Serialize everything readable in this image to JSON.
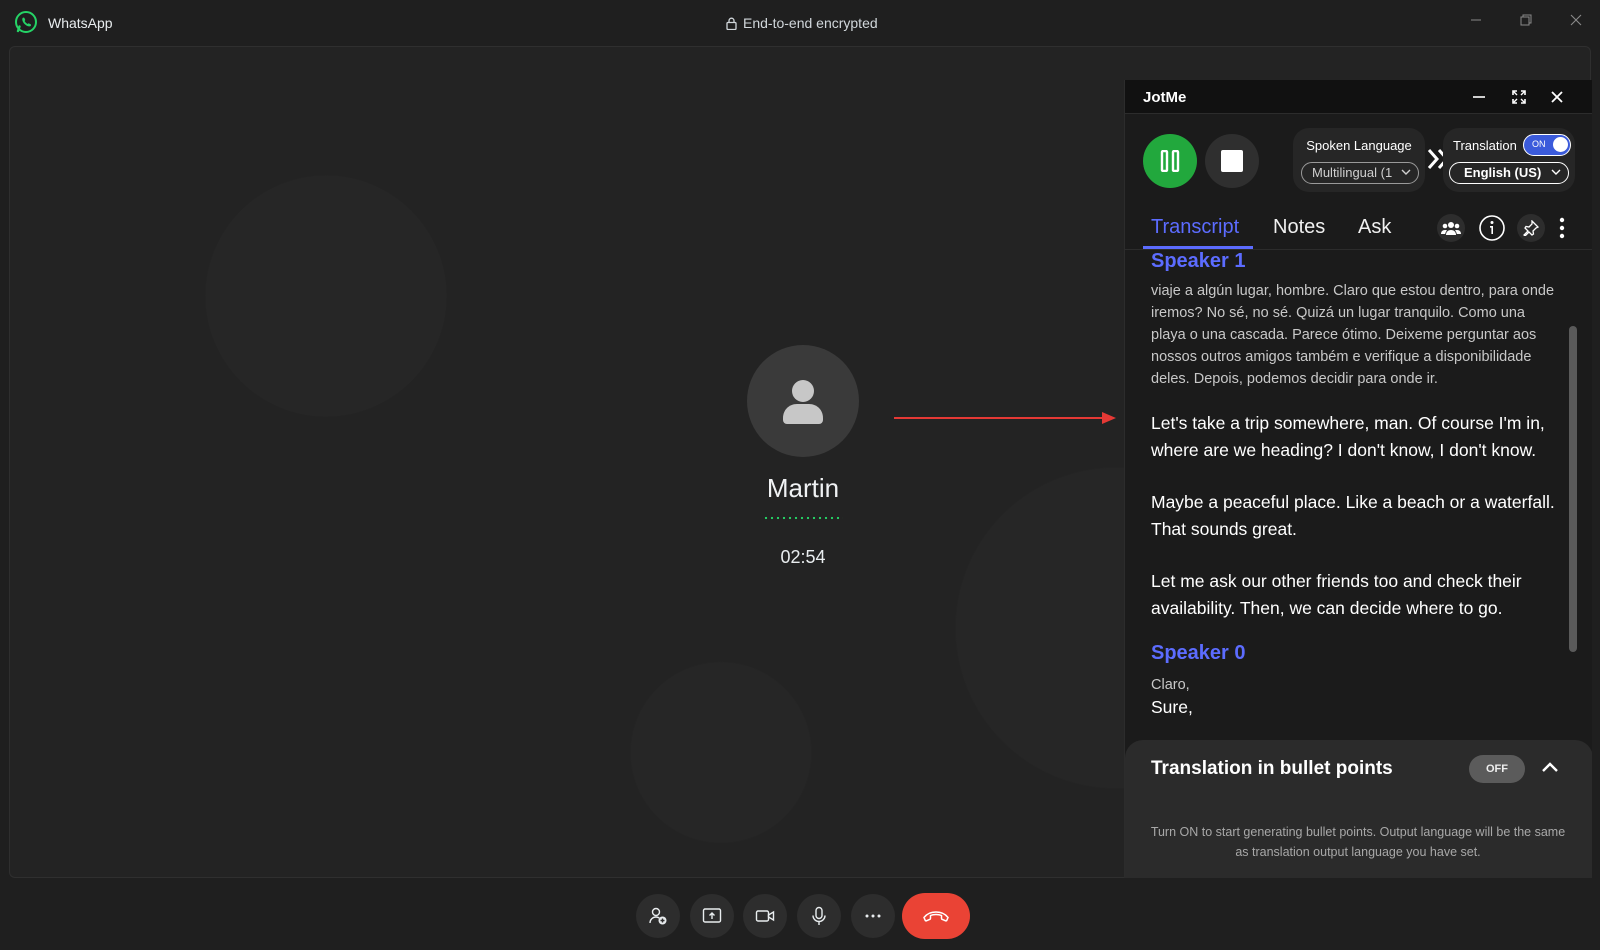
{
  "window": {
    "app_name": "WhatsApp",
    "encryption_text": "End-to-end encrypted",
    "icons": [
      "whatsapp-logo",
      "lock-icon",
      "minimize-icon",
      "maximize-icon",
      "close-icon"
    ]
  },
  "call": {
    "caller_name": "Martin",
    "duration": "02:54",
    "status_color": "#25d366"
  },
  "jotme": {
    "title": "JotMe",
    "spoken_language": {
      "label": "Spoken Language",
      "selected": "Multilingual (1"
    },
    "translation": {
      "label": "Translation",
      "toggle": "ON",
      "selected": "English (US)"
    },
    "tabs": [
      {
        "label": "Transcript",
        "active": true
      },
      {
        "label": "Notes",
        "active": false
      },
      {
        "label": "Ask",
        "active": false
      }
    ],
    "transcript": [
      {
        "speaker": "Speaker 1",
        "original": "viaje a algún lugar, hombre. Claro que estou dentro, para onde iremos? No sé, no sé. Quizá un lugar tranquilo. Como una playa o una cascada. Parece ótimo. Deixeme perguntar aos nossos outros amigos também e verifique a disponibilidade deles. Depois, podemos decidir para onde ir.",
        "translation": [
          "Let's take a trip somewhere, man. Of course I'm in, where are we heading? I don't know, I don't know.",
          "Maybe a peaceful place. Like a beach or a waterfall. That sounds great.",
          "Let me ask our other friends too and check their availability. Then, we can decide where to go."
        ]
      },
      {
        "speaker": "Speaker 0",
        "original": "Claro,",
        "translation": [
          "Sure,"
        ]
      }
    ],
    "bullets": {
      "title": "Translation in bullet points",
      "toggle": "OFF",
      "description": "Turn ON to start generating bullet points. Output language will be the same as translation output language you have set."
    },
    "accent_color": "#5c6cff",
    "record_color": "#22a83d"
  },
  "controls": {
    "items": [
      "add-participant-icon",
      "share-screen-icon",
      "video-icon",
      "microphone-icon",
      "more-icon",
      "end-call-icon"
    ],
    "end_call_color": "#ea4335"
  }
}
